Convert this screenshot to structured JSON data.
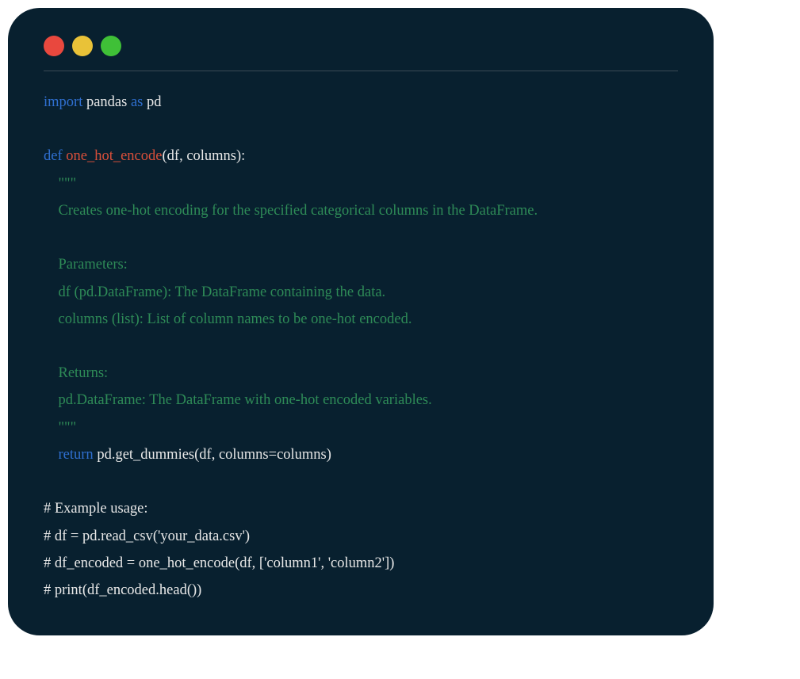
{
  "colors": {
    "background": "#08202f",
    "red": "#e9483e",
    "yellow": "#e9c238",
    "green": "#3fc037",
    "keyword": "#2f6fd0",
    "function": "#d94f3a",
    "docstring": "#2e8b57",
    "text": "#e8e8e8"
  },
  "code": {
    "line1_import": "import",
    "line1_module": " pandas ",
    "line1_as": "as",
    "line1_alias": " pd",
    "line3_def": "def",
    "line3_sp": " ",
    "line3_fn": "one_hot_encode",
    "line3_sig": "(df, columns):",
    "line4_doc": "    \"\"\"",
    "line5_doc": "    Creates one-hot encoding for the specified categorical columns in the DataFrame.",
    "line7_doc": "    Parameters:",
    "line8_doc": "    df (pd.DataFrame): The DataFrame containing the data.",
    "line9_doc": "    columns (list): List of column names to be one-hot encoded.",
    "line11_doc": "    Returns:",
    "line12_doc": "    pd.DataFrame: The DataFrame with one-hot encoded variables.",
    "line13_doc": "    \"\"\"",
    "line14_indent": "    ",
    "line14_return": "return",
    "line14_rest": " pd.get_dummies(df, columns=columns)",
    "line16": "# Example usage:",
    "line17": "# df = pd.read_csv('your_data.csv')",
    "line18": "# df_encoded = one_hot_encode(df, ['column1', 'column2'])",
    "line19": "# print(df_encoded.head())"
  }
}
